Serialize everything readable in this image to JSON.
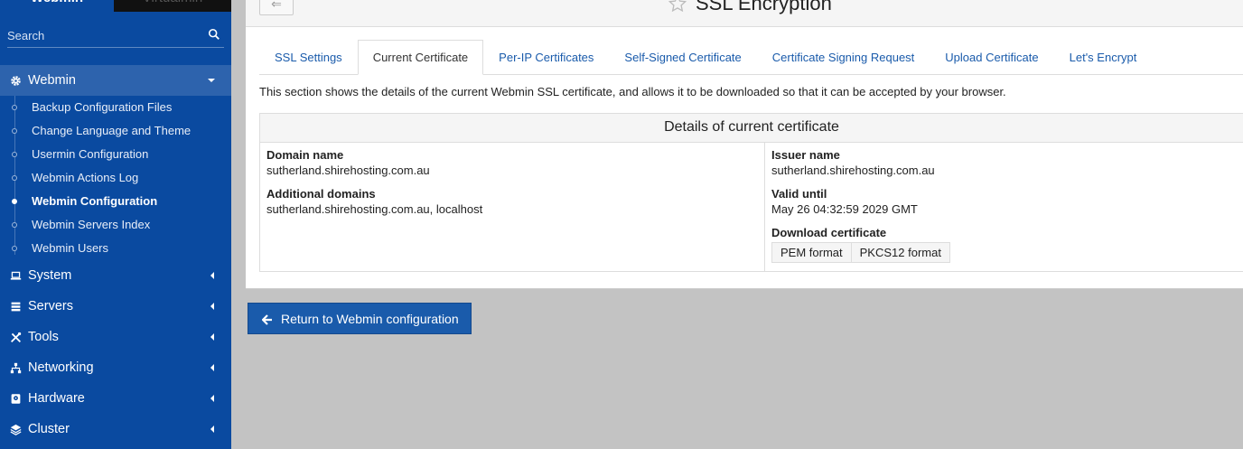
{
  "sidebar": {
    "top_tabs": [
      "Webmin",
      "Virtualmin"
    ],
    "search_placeholder": "Search",
    "active_category": "Webmin",
    "sub_items": [
      {
        "label": "Backup Configuration Files",
        "active": false
      },
      {
        "label": "Change Language and Theme",
        "active": false
      },
      {
        "label": "Usermin Configuration",
        "active": false
      },
      {
        "label": "Webmin Actions Log",
        "active": false
      },
      {
        "label": "Webmin Configuration",
        "active": true
      },
      {
        "label": "Webmin Servers Index",
        "active": false
      },
      {
        "label": "Webmin Users",
        "active": false
      }
    ],
    "categories": [
      {
        "label": "System",
        "icon": "laptop-icon"
      },
      {
        "label": "Servers",
        "icon": "server-icon"
      },
      {
        "label": "Tools",
        "icon": "tools-icon"
      },
      {
        "label": "Networking",
        "icon": "network-icon"
      },
      {
        "label": "Hardware",
        "icon": "hdd-icon"
      },
      {
        "label": "Cluster",
        "icon": "layers-icon"
      }
    ]
  },
  "header": {
    "title": "SSL Encryption",
    "back_label": "⇐"
  },
  "tabs": [
    {
      "label": "SSL Settings",
      "active": false
    },
    {
      "label": "Current Certificate",
      "active": true
    },
    {
      "label": "Per-IP Certificates",
      "active": false
    },
    {
      "label": "Self-Signed Certificate",
      "active": false
    },
    {
      "label": "Certificate Signing Request",
      "active": false
    },
    {
      "label": "Upload Certificate",
      "active": false
    },
    {
      "label": "Let's Encrypt",
      "active": false
    }
  ],
  "intro": "This section shows the details of the current Webmin SSL certificate, and allows it to be downloaded so that it can be accepted by your browser.",
  "certificate": {
    "heading": "Details of current certificate",
    "domain_name_label": "Domain name",
    "domain_name": "sutherland.shirehosting.com.au",
    "additional_domains_label": "Additional domains",
    "additional_domains": "sutherland.shirehosting.com.au, localhost",
    "issuer_name_label": "Issuer name",
    "issuer_name": "sutherland.shirehosting.com.au",
    "valid_until_label": "Valid until",
    "valid_until": "May 26 04:32:59 2029 GMT",
    "download_label": "Download certificate",
    "pem_label": "PEM format",
    "pkcs12_label": "PKCS12 format"
  },
  "return_button": "Return to Webmin configuration",
  "colors": {
    "sidebar_bg": "#0a4aa0",
    "sidebar_active": "#2d63ad",
    "link": "#1a5bab",
    "page_bg": "#c3c3c3"
  }
}
